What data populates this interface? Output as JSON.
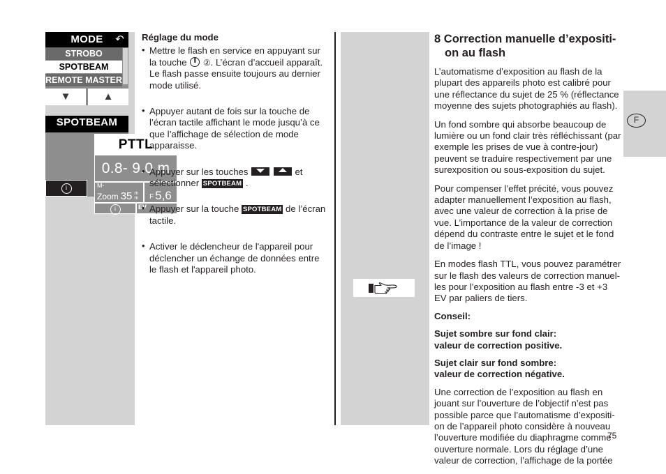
{
  "page": {
    "number": "75",
    "language_mark": "F"
  },
  "left_column": {
    "screens": [
      {
        "id": "pttl-screen",
        "title": "PTTL",
        "distance": "0.8- 9.0 m",
        "m_superscript": "M-",
        "zoom_label": "Zoom",
        "zoom_value": "35",
        "zoom_unit": "mm",
        "aperture_label": "F",
        "aperture_value": "5,6",
        "ev_label": "EV",
        "info_icon": "i"
      },
      {
        "id": "mode-screen",
        "title": "MODE",
        "back_icon": "↶",
        "items": [
          {
            "label": "STROBO",
            "selected": false
          },
          {
            "label": "SPOTBEAM",
            "selected": true
          },
          {
            "label": "REMOTE MASTER",
            "selected": false
          }
        ],
        "down_arrow": "▼",
        "up_arrow": "▲"
      },
      {
        "id": "spotbeam-screen",
        "title": "SPOTBEAM",
        "info_icon": "i"
      }
    ]
  },
  "middle_column": {
    "heading": "Réglage du mode",
    "bullets": [
      {
        "part1": "Mettre le flash en service en appuyant sur la touche ",
        "power_icon": "power-icon",
        "circled_two": "②",
        "part2": ". L’écran d’accueil apparaît. Le flash passe ensuite toujours au dernier mode utilisé."
      },
      {
        "text": "Appuyer autant de fois sur la touche de l’écran tactile affichant le mode jusqu’à ce que l’affichage de sélection de mode apparaisse."
      },
      {
        "part1": "Appuyer sur les touches ",
        "part2": " et sélectionner ",
        "token": "SPOTBEAM",
        "part3": " ."
      },
      {
        "part1": "Appuyer sur la touche ",
        "token": "SPOTBEAM",
        "part2": " de l’écran tactile."
      },
      {
        "text": "Activer le déclencheur de l'appareil pour déclencher un échange de données entre le flash et l'appareil photo."
      }
    ]
  },
  "right_column": {
    "section_number": "8",
    "section_title": "Correction manuelle d’expositi-",
    "section_title_line2": "on au flash",
    "paragraphs": [
      "L’automatisme d’exposition au flash de la plupart des appareils photo est calibré pour une réflectance du sujet de 25 % (réflectance moyenne des sujets photographiés au flash).",
      "Un fond sombre qui absorbe beaucoup de lumière ou un fond clair très réfléchissant (par exemple les prises de vue à contre-jour) peuvent se traduire respectivement par une surexposition ou sous-exposition du sujet.",
      "Pour compenser l’effet précité, vous pouvez adapter manuellement l’exposition au flash, avec une valeur de correction à la prise de vue. L’importance de la valeur de correction dépend du contraste entre le sujet et le fond de l’image !",
      "En modes flash TTL, vous pouvez paramétrer sur le flash des valeurs de correction manuel-les pour l’exposition au flash entre -3 et +3 EV par paliers de tiers."
    ],
    "tip_label": "Conseil:",
    "tips": [
      "Sujet sombre sur fond clair:\nvaleur de correction positive.",
      "Sujet clair sur fond sombre:\nvaleur de correction négative."
    ],
    "tip_1_line1": "Sujet sombre sur fond clair:",
    "tip_1_line2": "valeur de correction positive.",
    "tip_2_line1": "Sujet clair sur fond sombre:",
    "tip_2_line2": "valeur de correction négative.",
    "closing_paragraph": "Une correction de l’exposition au flash en jouant sur l’ouverture de l’objectif n’est pas possible parce que l’automatisme d’expositi-on de l’appareil photo considère à nouveau l’ouverture modifiée du diaphragme comme ouverture normale. Lors du réglage d’une valeur de correction, l’affichage de la portée"
  },
  "icons": {
    "hand_pointer": "pointing-hand-icon"
  },
  "colors": {
    "panel_gray": "#d3d3d3",
    "lcd_gray": "#8e8e8e",
    "lcd_dark": "#231f20",
    "text": "#231f20"
  }
}
